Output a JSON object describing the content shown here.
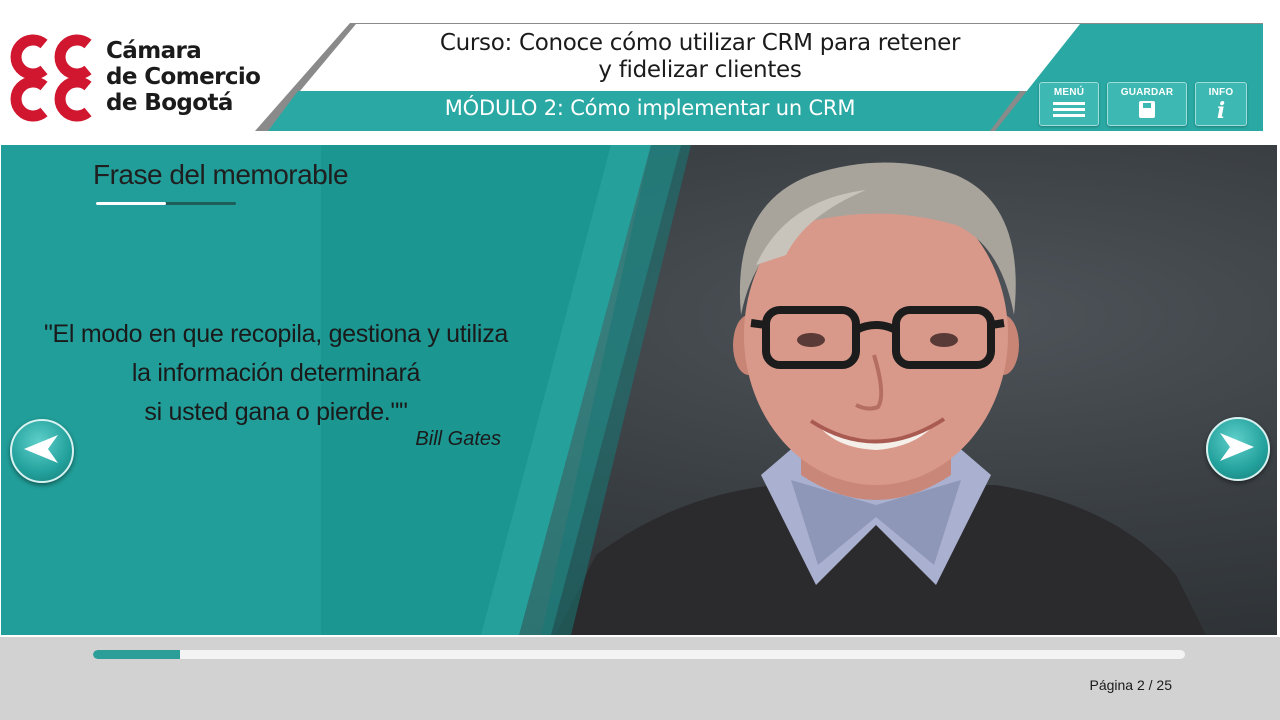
{
  "header": {
    "logo_lines": [
      "Cámara",
      "de Comercio",
      "de Bogotá"
    ],
    "course_title_lines": [
      "Curso: Conoce cómo utilizar CRM para retener",
      "y fidelizar clientes"
    ],
    "module_title": "MÓDULO 2: Cómo implementar un CRM",
    "buttons": {
      "menu": {
        "label": "MENÚ",
        "icon": "hamburger-icon"
      },
      "save": {
        "label": "GUARDAR",
        "icon": "save-icon"
      },
      "info": {
        "label": "INFO",
        "icon": "info-icon"
      }
    }
  },
  "slide": {
    "section_title": "Frase del memorable",
    "quote_lines": [
      "\"El modo en que recopila, gestiona y utiliza",
      "la información determinará",
      "si usted gana o pierde.\"\""
    ],
    "author": "Bill Gates",
    "prev_icon": "arrow-left-icon",
    "next_icon": "arrow-right-icon"
  },
  "footer": {
    "progress": 0.08,
    "page_label": "Página 2 / 25",
    "current_page": 2,
    "total_pages": 25
  },
  "colors": {
    "teal": "#2aa8a3",
    "teal_dark": "#219e99",
    "footer_gray": "#d2d2d2"
  }
}
